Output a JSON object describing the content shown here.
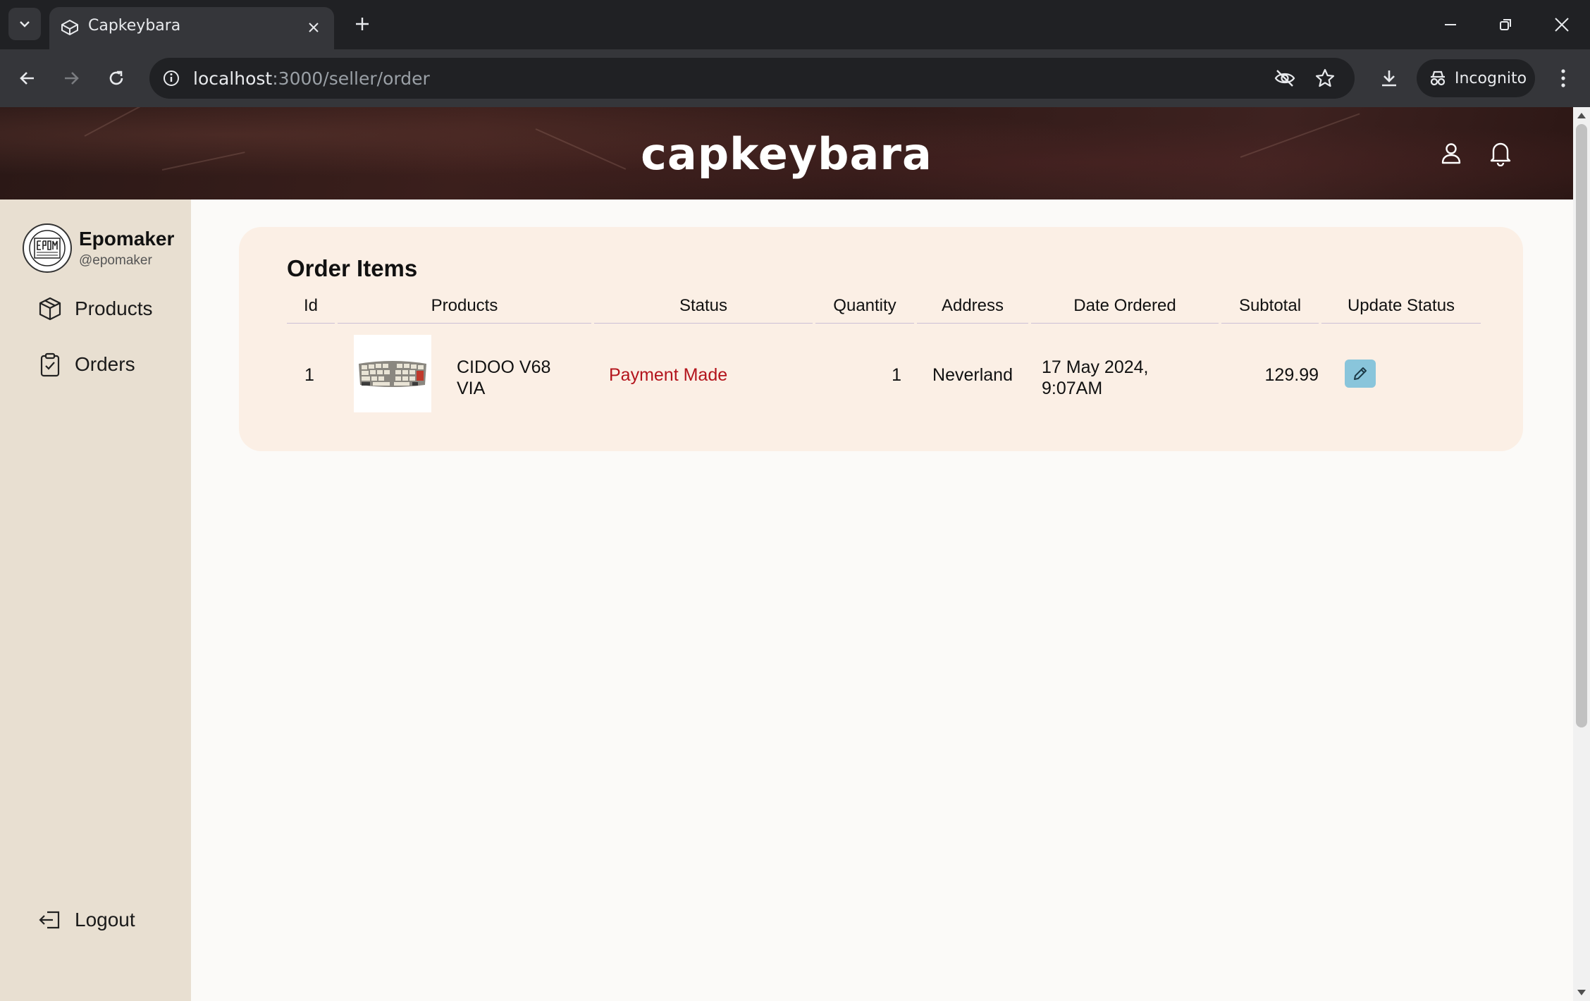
{
  "browser": {
    "tab_title": "Capkeybara",
    "url_host": "localhost",
    "url_path": ":3000/seller/order",
    "incognito_label": "Incognito"
  },
  "site": {
    "brand": "capkeybara"
  },
  "sidebar": {
    "store_name": "Epomaker",
    "store_handle": "@epomaker",
    "items": [
      {
        "label": "Products",
        "icon": "box-icon"
      },
      {
        "label": "Orders",
        "icon": "clipboard-check-icon"
      }
    ],
    "logout_label": "Logout"
  },
  "orders": {
    "title": "Order Items",
    "columns": [
      "Id",
      "Products",
      "Status",
      "Quantity",
      "Address",
      "Date Ordered",
      "Subtotal",
      "Update Status"
    ],
    "rows": [
      {
        "id": "1",
        "product_line1": "CIDOO V68",
        "product_line2": "VIA",
        "status": "Payment Made",
        "quantity": "1",
        "address": "Neverland",
        "date_line1": "17 May 2024,",
        "date_line2": "9:07AM",
        "subtotal": "129.99"
      }
    ]
  },
  "colors": {
    "status_text": "#b3141c",
    "edit_button": "#89c5db",
    "card_bg": "#fbefe5",
    "sidebar_bg": "#e8dfd1"
  }
}
